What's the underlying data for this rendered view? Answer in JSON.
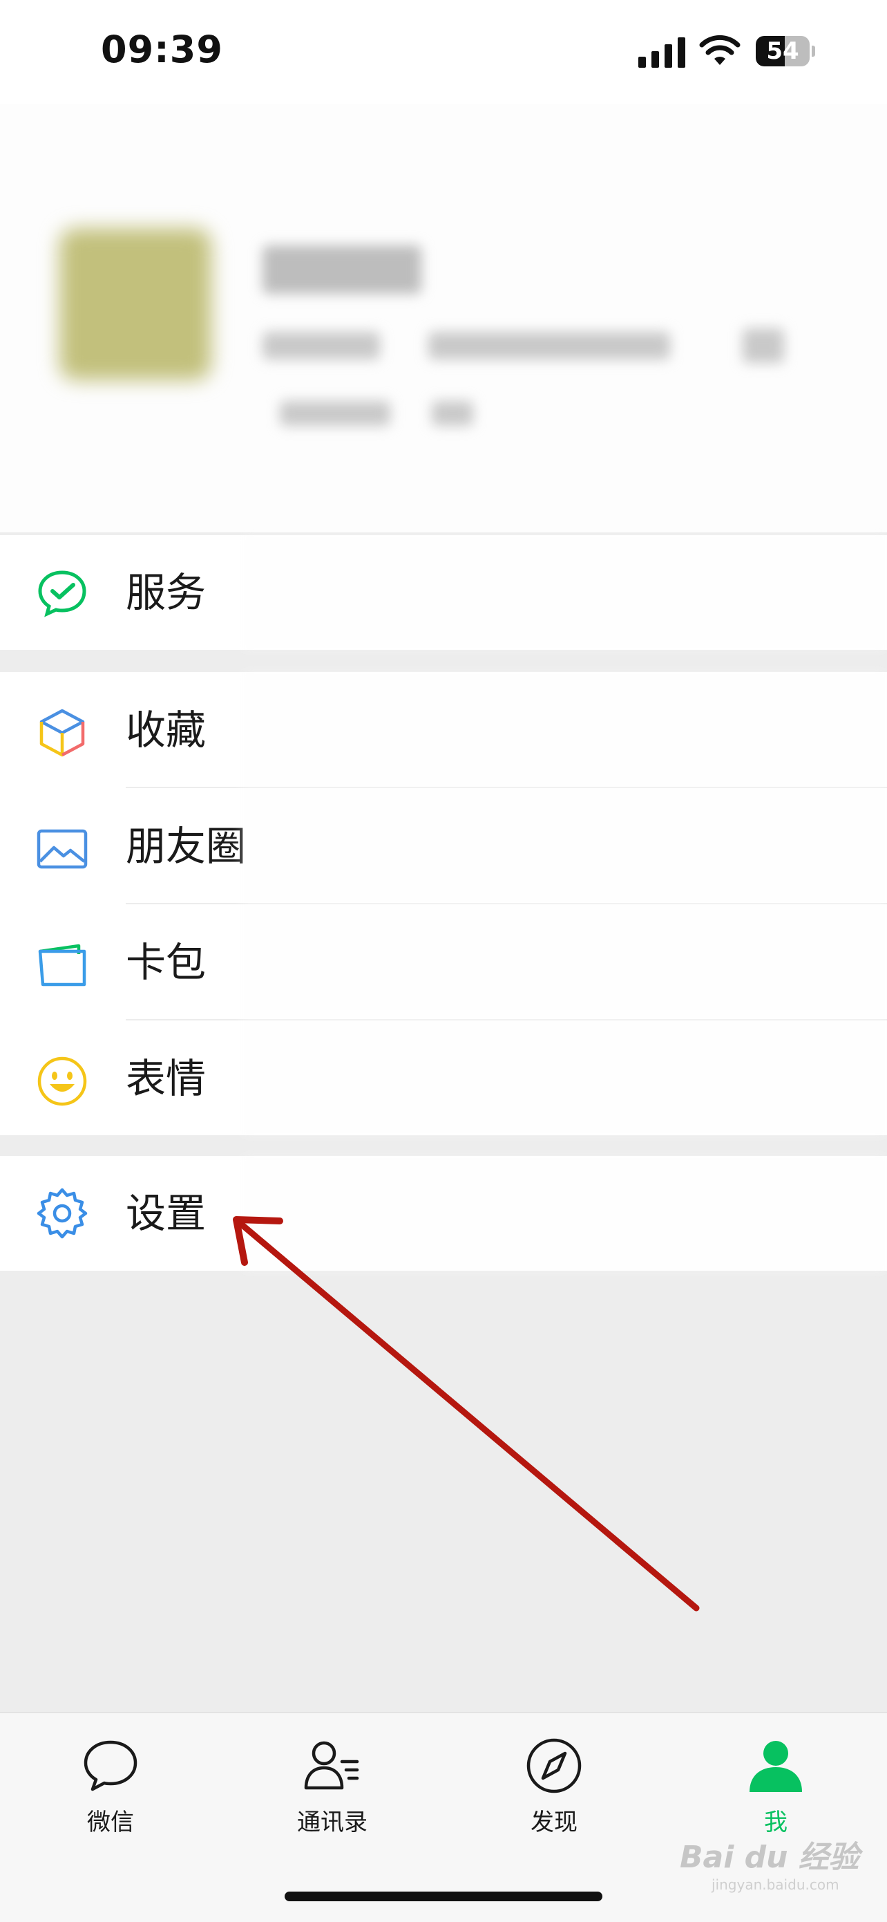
{
  "status_bar": {
    "time": "09:39",
    "battery": 54,
    "battery_label": "54",
    "icons": [
      "cellular-signal-icon",
      "wifi-icon",
      "battery-icon"
    ]
  },
  "profile": {
    "avatar_icon": "avatar",
    "blurred": true
  },
  "groups": {
    "service": {
      "items": [
        {
          "label": "服务",
          "icon": "wechat-pay-check-icon",
          "color": "#07c160"
        }
      ]
    },
    "main": {
      "items": [
        {
          "label": "收藏",
          "icon": "cube-icon",
          "color": "#4a90e2"
        },
        {
          "label": "朋友圈",
          "icon": "photo-icon",
          "color": "#4a90e2"
        },
        {
          "label": "卡包",
          "icon": "card-wallet-icon",
          "color": "#3a9ce8"
        },
        {
          "label": "表情",
          "icon": "smiley-icon",
          "color": "#f5c518"
        }
      ]
    },
    "settings": {
      "items": [
        {
          "label": "设置",
          "icon": "gear-icon",
          "color": "#3a8ee6"
        }
      ]
    }
  },
  "tabbar": {
    "tabs": [
      {
        "label": "微信",
        "icon": "chat-bubble-icon",
        "active": false
      },
      {
        "label": "通讯录",
        "icon": "contacts-icon",
        "active": false
      },
      {
        "label": "发现",
        "icon": "compass-icon",
        "active": false
      },
      {
        "label": "我",
        "icon": "person-icon",
        "active": true
      }
    ],
    "active_color": "#07c160"
  },
  "annotation": {
    "arrow_color": "#b5170f"
  },
  "watermark": {
    "brand": "Bai du 经验",
    "url": "jingyan.baidu.com"
  }
}
